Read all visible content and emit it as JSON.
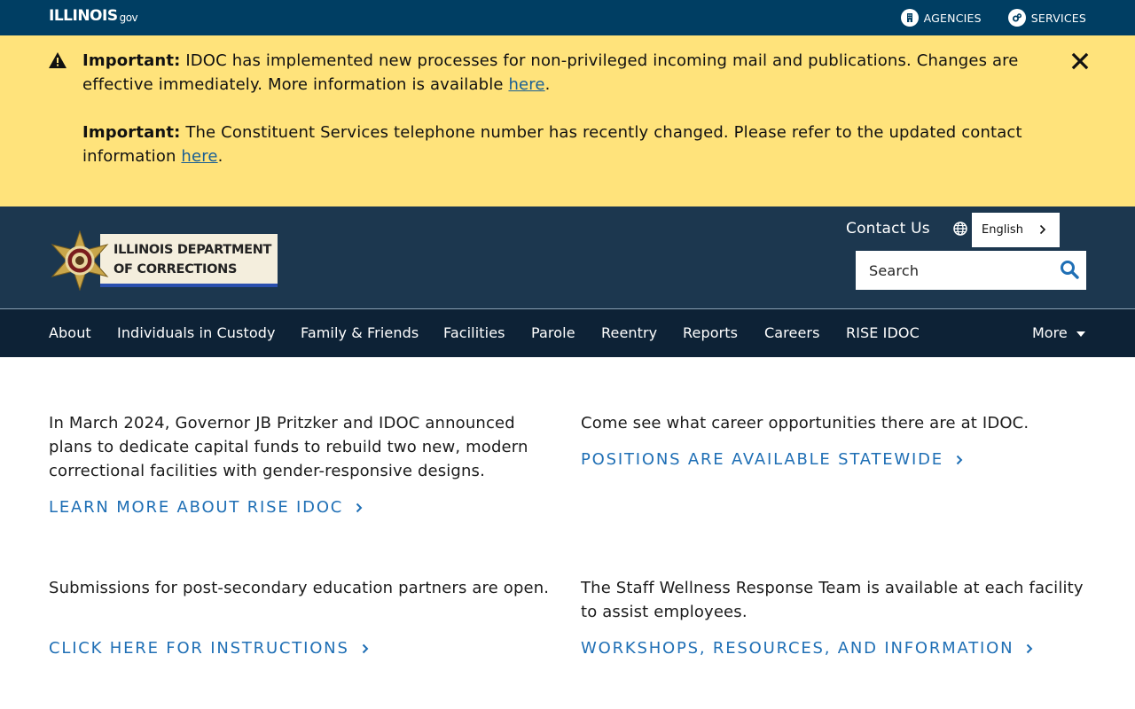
{
  "topbar": {
    "logo_text": "ILLINOIS",
    "logo_suffix": "gov",
    "agencies_label": "AGENCIES",
    "services_label": "SERVICES"
  },
  "alert": {
    "p1_strong": "Important:",
    "p1_text": " IDOC has implemented new processes for non-privileged incoming mail and publications. Changes are effective immediately. More information is available ",
    "p1_link": "here",
    "p1_end": ".",
    "p2_strong": "Important:",
    "p2_text": " The Constituent Services telephone number has recently changed. Please refer to the updated contact information ",
    "p2_link": "here",
    "p2_end": "."
  },
  "agency": {
    "name_line1": "ILLINOIS DEPARTMENT",
    "name_line2": "OF CORRECTIONS",
    "contact_label": "Contact Us",
    "language": "English",
    "search_placeholder": "Search"
  },
  "nav": {
    "items": [
      "About",
      "Individuals in Custody",
      "Family & Friends",
      "Facilities",
      "Parole",
      "Reentry",
      "Reports",
      "Careers",
      "RISE IDOC"
    ],
    "more_label": "More"
  },
  "content": {
    "block1_text": "In March 2024, Governor JB Pritzker and IDOC announced plans to dedicate capital funds to rebuild two new, modern correctional facilities with gender-responsive designs.",
    "block1_link": "LEARN MORE ABOUT RISE IDOC",
    "block2_text": "Come see what career opportunities there are at IDOC.",
    "block2_link": "POSITIONS ARE AVAILABLE STATEWIDE",
    "block3_text": "Submissions for post-secondary education partners are open.",
    "block3_link": "CLICK HERE FOR INSTRUCTIONS",
    "block4_text": "The Staff Wellness Response Team is available at each facility to assist employees.",
    "block4_link": "WORKSHOPS, RESOURCES, AND INFORMATION"
  },
  "colors": {
    "topbar": "#003e63",
    "alert": "#ffe37b",
    "agency_header": "#1c374f",
    "main_nav": "#0d2236",
    "link": "#1f6fb5"
  }
}
